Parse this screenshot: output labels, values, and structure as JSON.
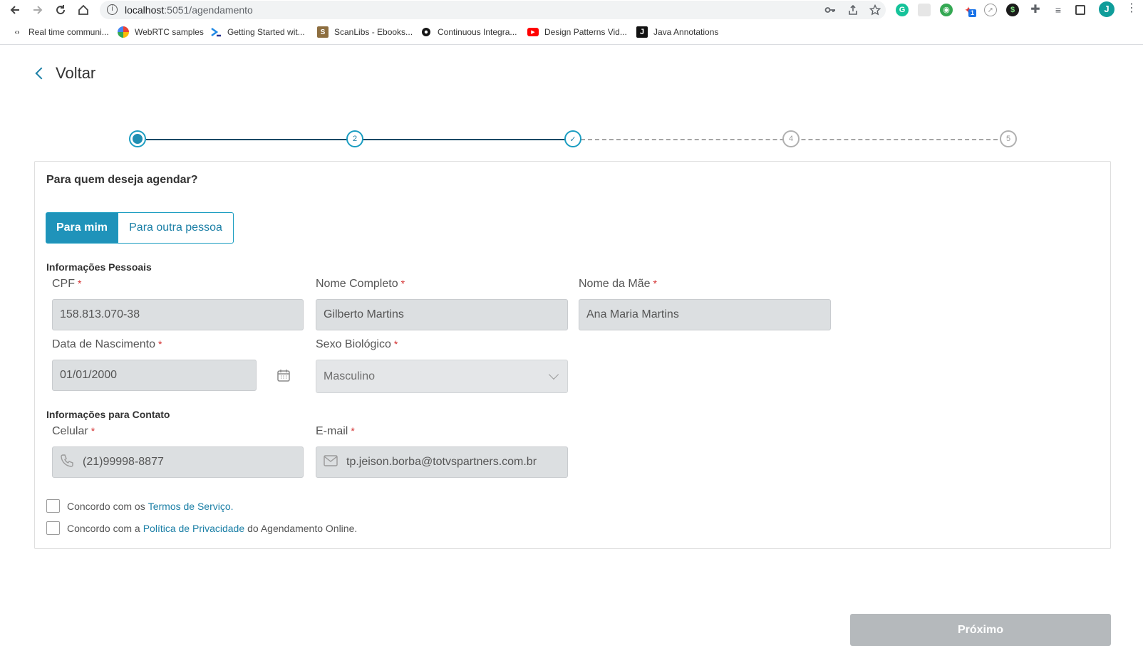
{
  "browser": {
    "url_host": "localhost",
    "url_rest": ":5051/agendamento",
    "profile_initial": "J",
    "extension_badge": "1",
    "bookmarks": [
      {
        "label": "Real time communi...",
        "icon": "code-icon"
      },
      {
        "label": "WebRTC samples",
        "icon": "webrtc-icon"
      },
      {
        "label": "Getting Started wit...",
        "icon": "vscode-icon"
      },
      {
        "label": "ScanLibs - Ebooks...",
        "icon": "scanlibs-icon",
        "glyph": "S"
      },
      {
        "label": "Continuous Integra...",
        "icon": "circleci-icon"
      },
      {
        "label": "Design Patterns Vid...",
        "icon": "youtube-icon"
      },
      {
        "label": "Java Annotations",
        "icon": "java-icon",
        "glyph": "J"
      }
    ]
  },
  "page": {
    "back_label": "Voltar",
    "steps": [
      {
        "state": "active",
        "label": ""
      },
      {
        "state": "pending-current",
        "label": "2"
      },
      {
        "state": "done",
        "label": "✓"
      },
      {
        "state": "pending",
        "label": "4"
      },
      {
        "state": "pending",
        "label": "5"
      }
    ],
    "question": "Para quem deseja agendar?",
    "options": {
      "selected": "Para mim",
      "other": "Para outra pessoa"
    },
    "personal_section": "Informações Pessoais",
    "contact_section": "Informações para Contato",
    "fields": {
      "cpf": {
        "label": "CPF",
        "value": "158.813.070-38"
      },
      "nome": {
        "label": "Nome Completo",
        "value": "Gilberto Martins"
      },
      "mae": {
        "label": "Nome da Mãe",
        "value": "Ana Maria Martins"
      },
      "nascimento": {
        "label": "Data de Nascimento",
        "value": "01/01/2000"
      },
      "sexo": {
        "label": "Sexo Biológico",
        "value": "Masculino"
      },
      "celular": {
        "label": "Celular",
        "value": "(21)99998-8877"
      },
      "email": {
        "label": "E-mail",
        "value": "tp.jeison.borba@totvspartners.com.br"
      }
    },
    "required_mark": "*",
    "terms": {
      "prefix": "Concordo com os",
      "link": "Termos de Serviço."
    },
    "privacy": {
      "prefix": "Concordo com a",
      "link": "Política de Privacidade",
      "suffix": "do Agendamento Online."
    },
    "next_label": "Próximo"
  },
  "colors": {
    "accent": "#1f93ba",
    "step_line": "#0d4a66",
    "required": "#d32f2f",
    "disabled_button": "#b5b9bc"
  }
}
